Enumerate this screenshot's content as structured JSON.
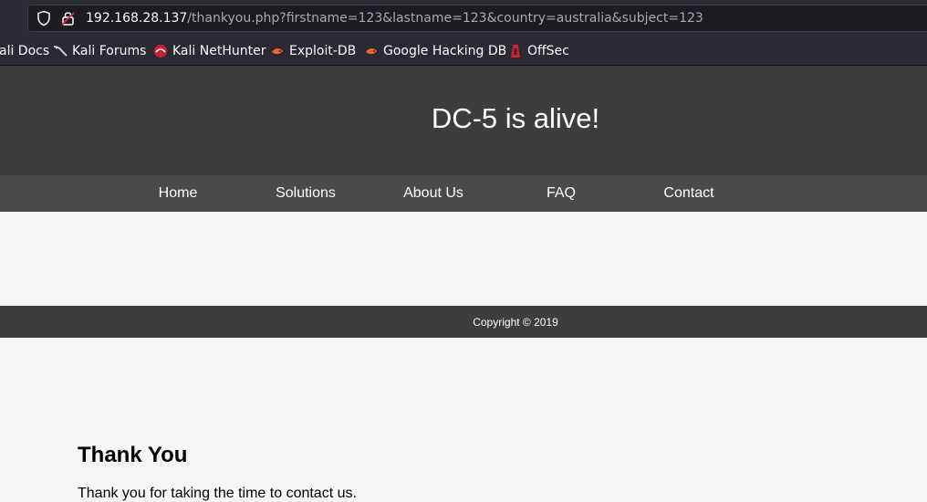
{
  "browser": {
    "url_host": "192.168.28.137",
    "url_path": "/thankyou.php?firstname=123&lastname=123&country=australia&subject=123",
    "bookmarks": [
      {
        "label": "ali Docs",
        "icon": "kali-docs-icon"
      },
      {
        "label": "Kali Forums",
        "icon": "kali-forums-icon"
      },
      {
        "label": "Kali NetHunter",
        "icon": "kali-nethunter-icon"
      },
      {
        "label": "Exploit-DB",
        "icon": "exploit-db-icon"
      },
      {
        "label": "Google Hacking DB",
        "icon": "google-hacking-db-icon"
      },
      {
        "label": "OffSec",
        "icon": "offsec-icon"
      }
    ]
  },
  "site": {
    "title": "DC-5 is alive!",
    "nav": [
      "Home",
      "Solutions",
      "About Us",
      "FAQ",
      "Contact"
    ],
    "heading": "Thank You",
    "message": "Thank you for taking the time to contact us.",
    "footer": "Copyright © 2019"
  }
}
